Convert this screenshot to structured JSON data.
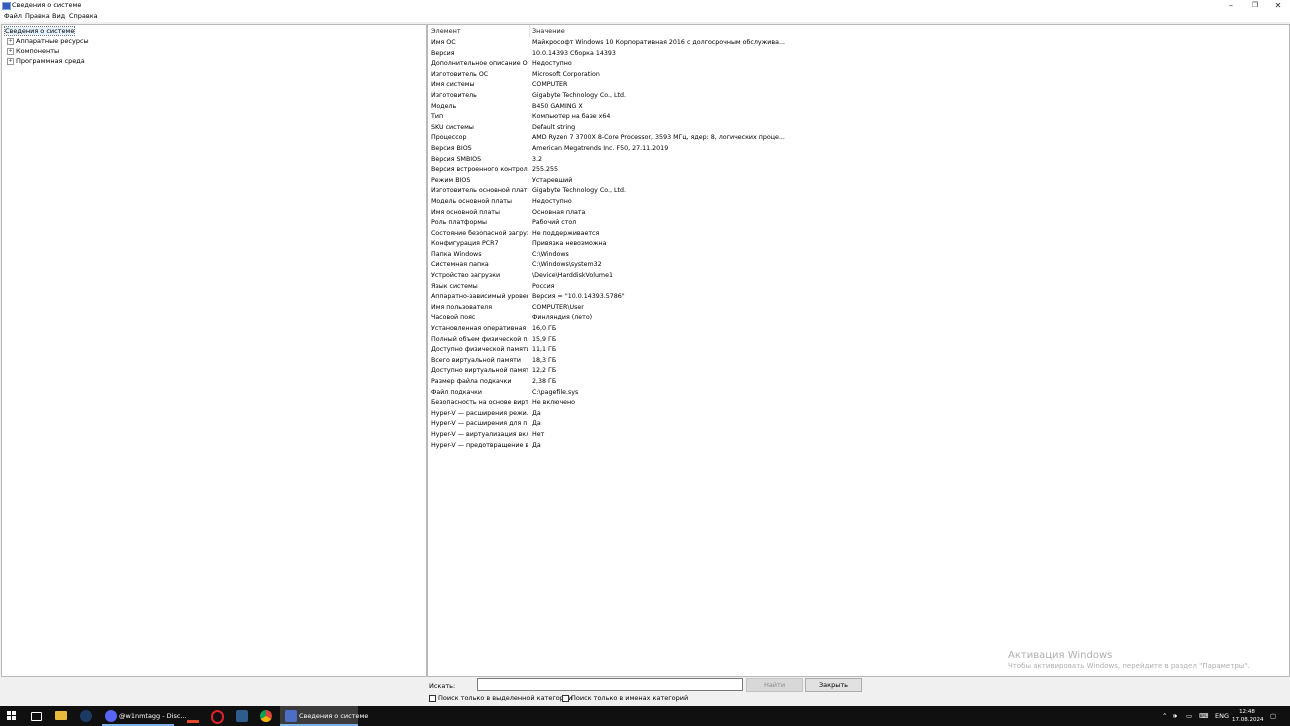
{
  "window": {
    "title": "Сведения о системе",
    "controls": {
      "minimize": "–",
      "restore": "❐",
      "close": "✕"
    }
  },
  "menu": [
    "Файл",
    "Правка",
    "Вид",
    "Справка"
  ],
  "tree": {
    "root": "Сведения о системе",
    "children": [
      "Аппаратные ресурсы",
      "Компоненты",
      "Программная среда"
    ]
  },
  "table": {
    "headers": [
      "Элемент",
      "Значение"
    ],
    "rows": [
      [
        "Имя ОС",
        "Майкрософт Windows 10 Корпоративная 2016 с долгосрочным обслужива..."
      ],
      [
        "Версия",
        "10.0.14393 Сборка 14393"
      ],
      [
        "Дополнительное описание ОС",
        "Недоступно"
      ],
      [
        "Изготовитель ОС",
        "Microsoft Corporation"
      ],
      [
        "Имя системы",
        "COMPUTER"
      ],
      [
        "Изготовитель",
        "Gigabyte Technology Co., Ltd."
      ],
      [
        "Модель",
        "B450 GAMING X"
      ],
      [
        "Тип",
        "Компьютер на базе x64"
      ],
      [
        "SKU системы",
        "Default string"
      ],
      [
        "Процессор",
        "AMD Ryzen 7 3700X 8-Core Processor, 3593 МГц, ядер: 8, логических проце..."
      ],
      [
        "Версия BIOS",
        "American Megatrends Inc. F50, 27.11.2019"
      ],
      [
        "Версия SMBIOS",
        "3.2"
      ],
      [
        "Версия встроенного контролл...",
        "255.255"
      ],
      [
        "Режим BIOS",
        "Устаревший"
      ],
      [
        "Изготовитель основной платы",
        "Gigabyte Technology Co., Ltd."
      ],
      [
        "Модель основной платы",
        "Недоступно"
      ],
      [
        "Имя основной платы",
        "Основная плата"
      ],
      [
        "Роль платформы",
        "Рабочий стол"
      ],
      [
        "Состояние безопасной загруз...",
        "Не поддерживается"
      ],
      [
        "Конфигурация PCR7",
        "Привязка невозможна"
      ],
      [
        "Папка Windows",
        "C:\\Windows"
      ],
      [
        "Системная папка",
        "C:\\Windows\\system32"
      ],
      [
        "Устройство загрузки",
        "\\Device\\HarddiskVolume1"
      ],
      [
        "Язык системы",
        "Россия"
      ],
      [
        "Аппаратно-зависимый уровен...",
        "Версия = \"10.0.14393.5786\""
      ],
      [
        "Имя пользователя",
        "COMPUTER\\User"
      ],
      [
        "Часовой пояс",
        "Финляндия (лето)"
      ],
      [
        "Установленная оперативная п...",
        "16,0 ГБ"
      ],
      [
        "Полный объем физической па...",
        "15,9 ГБ"
      ],
      [
        "Доступно физической памяти",
        "11,1 ГБ"
      ],
      [
        "Всего виртуальной памяти",
        "18,3 ГБ"
      ],
      [
        "Доступно виртуальной памяти",
        "12,2 ГБ"
      ],
      [
        "Размер файла подкачки",
        "2,38 ГБ"
      ],
      [
        "Файл подкачки",
        "C:\\pagefile.sys"
      ],
      [
        "Безопасность на основе вирту...",
        "Не включено"
      ],
      [
        "Hyper-V — расширения режи...",
        "Да"
      ],
      [
        "Hyper-V — расширения для п...",
        "Да"
      ],
      [
        "Hyper-V — виртуализация вкл...",
        "Нет"
      ],
      [
        "Hyper-V — предотвращение в...",
        "Да"
      ]
    ]
  },
  "watermark": {
    "line1": "Активация Windows",
    "line2": "Чтобы активировать Windows, перейдите в раздел \"Параметры\"."
  },
  "search": {
    "label": "Искать:",
    "value": "",
    "find_button": "Найти",
    "close_button": "Закрыть",
    "option_selected_category": "Поиск только в выделенной категории",
    "option_category_names": "Поиск только в именах категорий"
  },
  "taskbar": {
    "discord_task": "@w1nmtagg - Disc...",
    "msinfo_task": "Сведения о системе",
    "lang": "ENG",
    "time": "12:48",
    "date": "17.08.2024"
  }
}
